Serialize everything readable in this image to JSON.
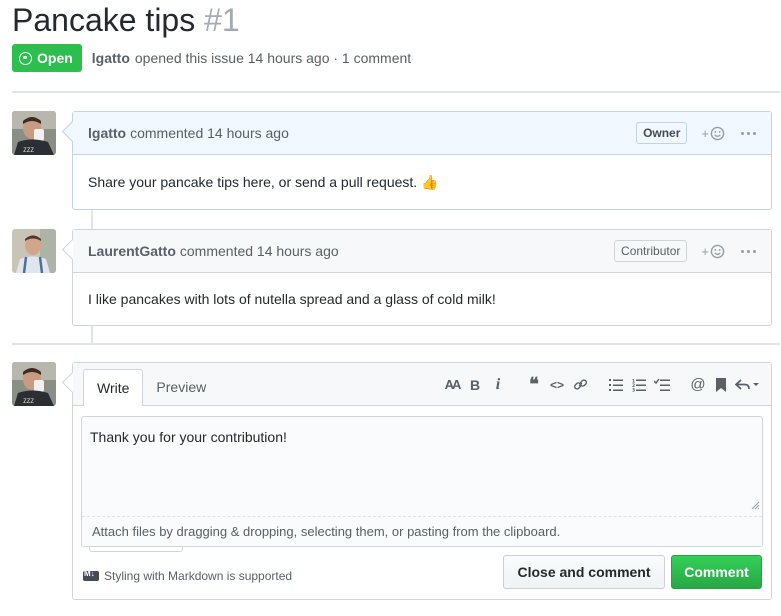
{
  "issue": {
    "title": "Pancake tips",
    "number": "#1",
    "state": "Open",
    "author": "lgatto",
    "opened_text": "opened this issue 14 hours ago · 1 comment"
  },
  "comments": [
    {
      "author": "lgatto",
      "action": "commented 14 hours ago",
      "role": "Owner",
      "body": "Share your pancake tips here, or send a pull request. 👍"
    },
    {
      "author": "LaurentGatto",
      "action": "commented 14 hours ago",
      "role": "Contributor",
      "body": "I like pancakes with lots of nutella spread and a glass of cold milk!"
    }
  ],
  "editor": {
    "tabs": [
      "Write",
      "Preview"
    ],
    "toolbar": {
      "heading": "AA",
      "bold": "B",
      "italic": "i",
      "quote": "❝",
      "code": "<>",
      "link": "link-icon",
      "bullet_list": "bullet-list-icon",
      "numbered_list": "numbered-list-icon",
      "task_list": "task-list-icon",
      "mention": "@",
      "saved_reply": "bookmark-icon",
      "reply": "reply-icon"
    },
    "text": "Thank you for your contribution!",
    "attach_hint": "Attach files by dragging & dropping, selecting them, or pasting from the clipboard.",
    "markdown_note": "Styling with Markdown is supported",
    "close_label": "Close and comment",
    "comment_label": "Comment"
  },
  "colors": {
    "open_green": "#2cbe4e",
    "owner_header": "#f1f8ff",
    "comment_button": "#28a745"
  }
}
